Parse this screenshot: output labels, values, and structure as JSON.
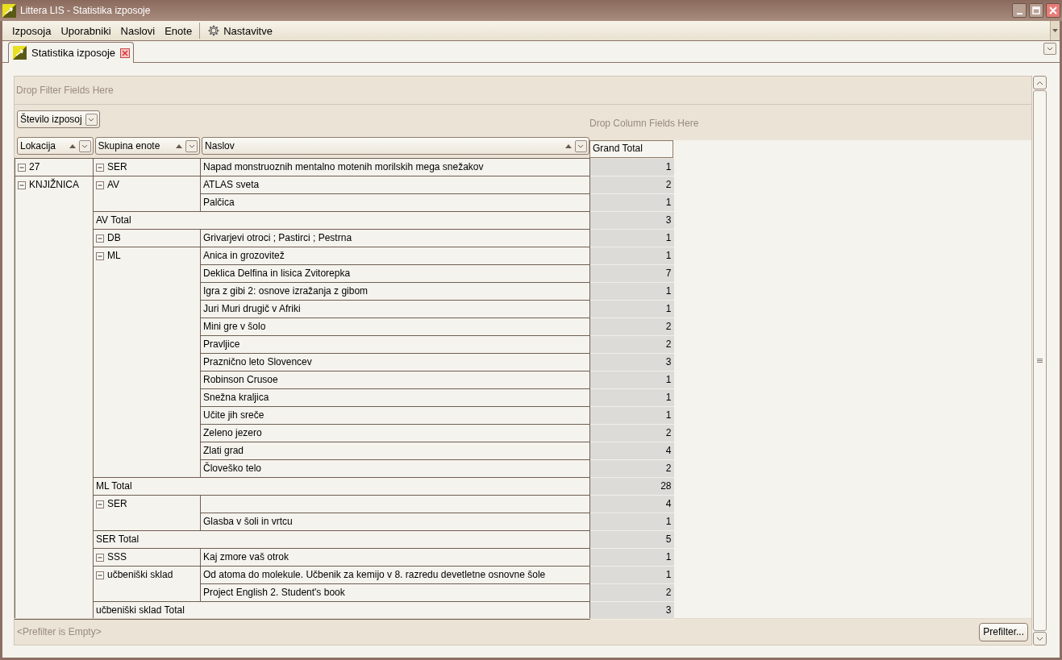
{
  "window": {
    "title": "Littera LIS - Statistika izposoje"
  },
  "menu": [
    {
      "label": "Izposoja",
      "kind": "plain"
    },
    {
      "label": "Uporabniki",
      "kind": "plain"
    },
    {
      "label": "Naslovi",
      "kind": "plain"
    },
    {
      "label": "Enote",
      "kind": "plain"
    },
    {
      "label": "Nastavitve",
      "kind": "settings"
    }
  ],
  "tabs": [
    {
      "label": "Statistika izposoje",
      "selected": true
    }
  ],
  "pivot": {
    "filter_area_hint": "Drop Filter Fields Here",
    "data_field": "Število izposoj",
    "column_area_hint": "Drop Column Fields Here",
    "row_fields": [
      {
        "label": "Lokacija",
        "sort_ascending": true
      },
      {
        "label": "Skupina enote",
        "sort_ascending": true
      },
      {
        "label": "Naslov",
        "sort_ascending": true
      }
    ],
    "grand_total_header": "Grand Total",
    "locations": [
      {
        "name": "27",
        "expanded": true,
        "groups": [
          {
            "name": "SER",
            "expanded": true,
            "titles": [
              {
                "title": "Napad monstruoznih mentalno motenih morilskih mega snežakov",
                "value": "1"
              }
            ]
          }
        ]
      },
      {
        "name": "KNJIŽNICA",
        "expanded": true,
        "groups": [
          {
            "name": "AV",
            "expanded": true,
            "titles": [
              {
                "title": "ATLAS sveta",
                "value": "2"
              },
              {
                "title": "Palčica",
                "value": "1"
              }
            ],
            "total": {
              "label": "AV Total",
              "value": "3"
            }
          },
          {
            "name": "DB",
            "expanded": true,
            "titles": [
              {
                "title": "Grivarjevi otroci ; Pastirci ; Pestrna",
                "value": "1"
              }
            ]
          },
          {
            "name": "ML",
            "expanded": true,
            "titles": [
              {
                "title": "Anica in grozovitež",
                "value": "1"
              },
              {
                "title": "Deklica Delfina in lisica Zvitorepka",
                "value": "7"
              },
              {
                "title": "Igra z gibi 2: osnove izražanja  z gibom",
                "value": "1"
              },
              {
                "title": "Juri Muri drugič v Afriki",
                "value": "1"
              },
              {
                "title": "Mini gre v šolo",
                "value": "2"
              },
              {
                "title": "Pravljice",
                "value": "2"
              },
              {
                "title": "Praznično leto Slovencev",
                "value": "3"
              },
              {
                "title": "Robinson Crusoe",
                "value": "1"
              },
              {
                "title": "Snežna kraljica",
                "value": "1"
              },
              {
                "title": "Učite jih sreče",
                "value": "1"
              },
              {
                "title": "Zeleno jezero",
                "value": "2"
              },
              {
                "title": "Zlati grad",
                "value": "4"
              },
              {
                "title": "Človeško telo",
                "value": "2"
              }
            ],
            "total": {
              "label": "ML Total",
              "value": "28"
            }
          },
          {
            "name": "SER",
            "expanded": true,
            "titles": [
              {
                "value": "4"
              },
              {
                "title": "Glasba v šoli in vrtcu",
                "value": "1"
              }
            ],
            "total": {
              "label": "SER Total",
              "value": "5"
            }
          },
          {
            "name": "SSS",
            "expanded": true,
            "titles": [
              {
                "title": "Kaj zmore vaš otrok",
                "value": "1"
              }
            ]
          },
          {
            "name": "učbeniški sklad",
            "expanded": true,
            "titles": [
              {
                "title": "Od atoma do molekule. Učbenik za kemijo v 8. razredu devetletne osnovne šole",
                "value": "1"
              },
              {
                "title": "Project English 2. Student's book",
                "value": "2"
              }
            ],
            "total": {
              "label": "učbeniški sklad Total",
              "value": "3"
            }
          }
        ]
      }
    ],
    "prefilter": "<Prefilter is Empty>",
    "prefilter_button": "Prefilter..."
  }
}
